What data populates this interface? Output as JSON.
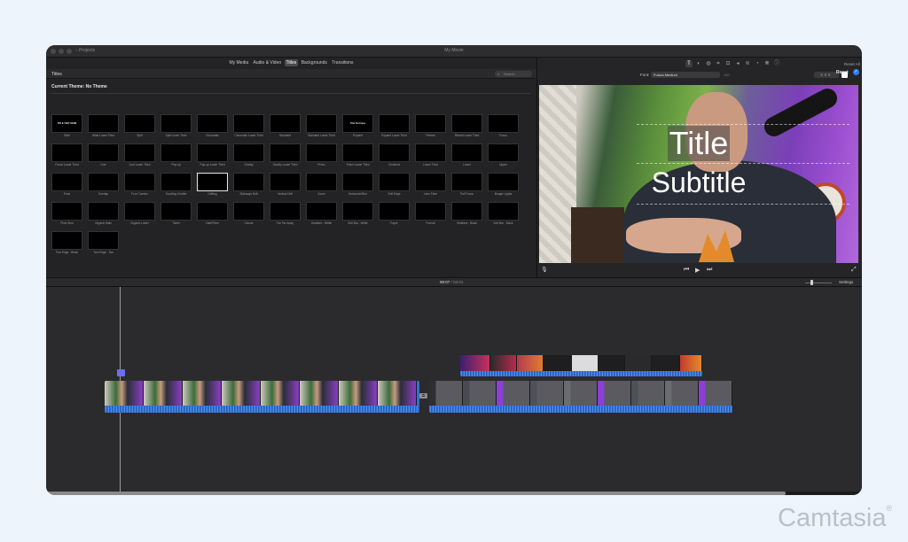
{
  "window": {
    "title": "My Movie",
    "toolbar_left": "Projects"
  },
  "browser": {
    "tabs": [
      {
        "label": "My Media",
        "active": false
      },
      {
        "label": "Audio & Video",
        "active": false
      },
      {
        "label": "Titles",
        "active": true
      },
      {
        "label": "Backgrounds",
        "active": false
      },
      {
        "label": "Transitions",
        "active": false
      }
    ],
    "header_title": "Titles",
    "search_placeholder": "Search",
    "current_theme": "Current Theme: No Theme",
    "titles": [
      "Slide",
      "Wide Lower Third",
      "Split",
      "Split Lower Third",
      "Chromatic",
      "Chromatic Lower Third",
      "Standard",
      "Standard Lower Third",
      "Expand",
      "Expand Lower Third",
      "Reveal",
      "Reveal Lower Third",
      "Focus",
      "Focus Lower Third",
      "Line",
      "Line Lower Third",
      "Pop-up",
      "Pop-up Lower Third",
      "Gravity",
      "Gravity Lower Third",
      "Prism",
      "Prism Lower Third",
      "Centered",
      "Lower Third",
      "Lower",
      "Upper",
      "Ends",
      "Overlap",
      "Four Corners",
      "Scrolling Credits",
      "Drifting",
      "Sideways Drift",
      "Vertical Drift",
      "Zoom",
      "Horizontal Blur",
      "Soft Edge",
      "Lens Flare",
      "Pull Focus",
      "Boogie Lights",
      "Pixie Dust",
      "Organic Main",
      "Organic Lower",
      "Ticker",
      "Date/Time",
      "Clouds",
      "Far Far Away",
      "Gradient - White",
      "Soft Bar - White",
      "Paper",
      "Formal",
      "Gradient - Black",
      "Soft Bar - Black",
      "Torn Edge - Black",
      "Torn Edge - Tan"
    ],
    "thumb_texts": [
      "TITLE TEXT HERE",
      "",
      "",
      "",
      "",
      "",
      "",
      "",
      "Title Text Here",
      "",
      "",
      "",
      ""
    ],
    "selected_title": "Drifting"
  },
  "viewer": {
    "reset_all": "Reset All",
    "font_label": "Font:",
    "font_value": "Futura Medium",
    "font_size": "100",
    "reset_label": "Reset",
    "title_text": "Title",
    "subtitle_text": "Subtitle"
  },
  "timeline": {
    "timecode_current": "00:07",
    "timecode_sep": "/",
    "timecode_total": "04:01",
    "settings_label": "Settings"
  },
  "watermark": {
    "brand": "Camtasia",
    "mark": "®"
  },
  "colors": {
    "accent": "#2e7cf6",
    "audio_wave": "#2f6fd6",
    "window_bg": "#1c1c1e"
  }
}
